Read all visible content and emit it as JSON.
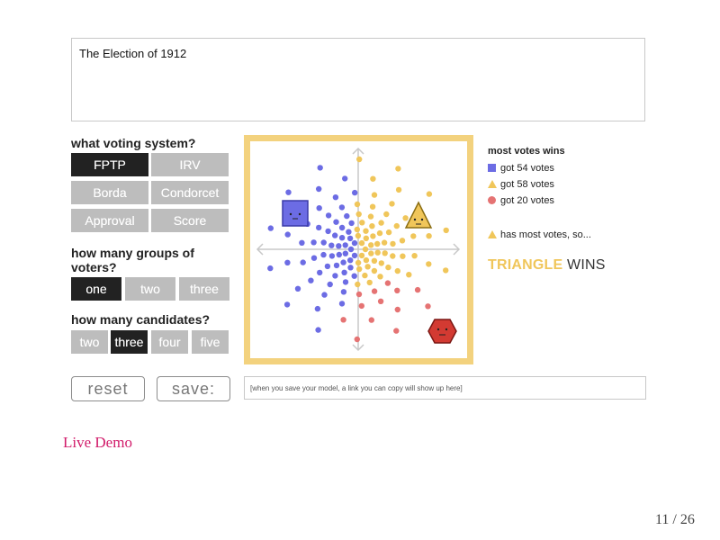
{
  "title_box": {
    "text": "The Election of 1912"
  },
  "voting_system": {
    "label": "what voting system?",
    "options": [
      "FPTP",
      "IRV",
      "Borda",
      "Condorcet",
      "Approval",
      "Score"
    ],
    "selected": "FPTP"
  },
  "groups": {
    "label_line1": "how many groups of",
    "label_line2": "voters?",
    "options": [
      "one",
      "two",
      "three"
    ],
    "selected": "one"
  },
  "candidates": {
    "label": "how many candidates?",
    "options": [
      "two",
      "three",
      "four",
      "five"
    ],
    "selected": "three"
  },
  "results": {
    "heading": "most votes wins",
    "square_votes": "got 54 votes",
    "triangle_votes": "got 58 votes",
    "circle_votes": "got 20 votes",
    "summary": "has most votes, so...",
    "winner_name": "TRIANGLE",
    "winner_suffix": "WINS"
  },
  "colors": {
    "square": "#6c6ce4",
    "triangle": "#f0c65a",
    "circle": "#e57373",
    "frame": "#f3d27e"
  },
  "actions": {
    "reset_label": "reset",
    "save_label": "save:",
    "link_placeholder": "[when you save your model, a link you can copy will show up here]"
  },
  "footer": {
    "live_demo": "Live Demo",
    "page": "11 / 26"
  }
}
